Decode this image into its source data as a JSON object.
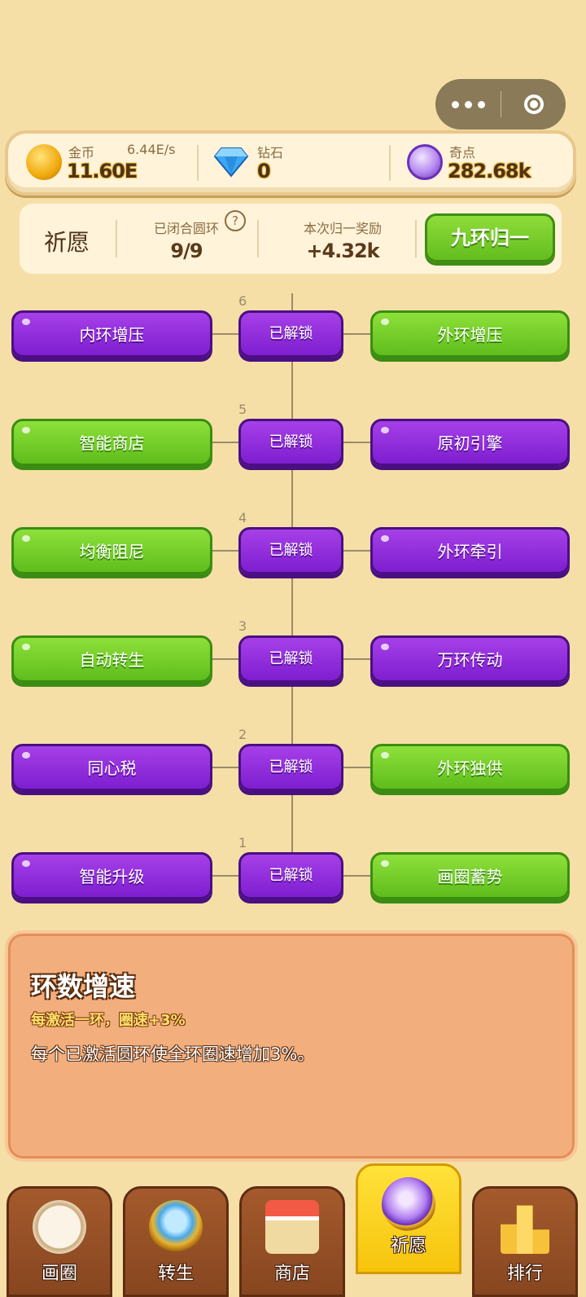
{
  "currency": {
    "gold": {
      "label": "金币",
      "value": "11.60E",
      "rate": "6.44E/s"
    },
    "diamond": {
      "label": "钻石",
      "value": "0"
    },
    "orb": {
      "label": "奇点",
      "value": "282.68k"
    }
  },
  "wish_bar": {
    "title": "祈愿",
    "closed_label": "已闭合圆环",
    "closed_value": "9/9",
    "help": "?",
    "reward_label": "本次归一奖励",
    "reward_value": "+4.32k",
    "button": "九环归一"
  },
  "tree": {
    "unlocked_label": "已解锁",
    "rows": [
      {
        "level": "6",
        "left": "内环增压",
        "left_color": "purple",
        "right": "外环增压",
        "right_color": "green"
      },
      {
        "level": "5",
        "left": "智能商店",
        "left_color": "green",
        "right": "原初引擎",
        "right_color": "purple"
      },
      {
        "level": "4",
        "left": "均衡阻尼",
        "left_color": "green",
        "right": "外环牵引",
        "right_color": "purple"
      },
      {
        "level": "3",
        "left": "自动转生",
        "left_color": "green",
        "right": "万环传动",
        "right_color": "purple"
      },
      {
        "level": "2",
        "left": "同心税",
        "left_color": "purple",
        "right": "外环独供",
        "right_color": "green"
      },
      {
        "level": "1",
        "left": "智能升级",
        "left_color": "purple",
        "right": "画圈蓄势",
        "right_color": "green"
      }
    ]
  },
  "description": {
    "title": "环数增速",
    "subtitle": "每激活一环，圈速+3%",
    "body": "每个已激活圆环使全环圈速增加3%。"
  },
  "tabs": [
    {
      "label": "画圈",
      "icon": "pencil-circle-icon"
    },
    {
      "label": "转生",
      "icon": "diamond-ring-icon"
    },
    {
      "label": "商店",
      "icon": "shop-icon"
    },
    {
      "label": "祈愿",
      "icon": "crystal-ball-icon",
      "active": true
    },
    {
      "label": "排行",
      "icon": "podium-icon"
    }
  ],
  "colors": {
    "purple": "#8a2be2",
    "green": "#6cc624",
    "background": "#f6dfa6"
  }
}
